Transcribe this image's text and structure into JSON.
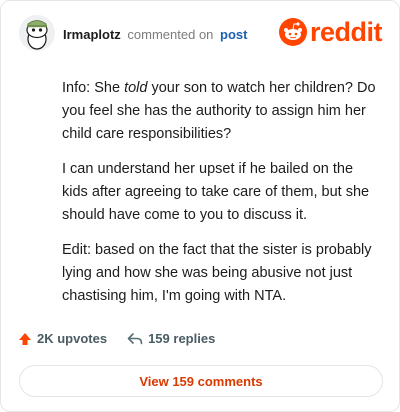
{
  "comment": {
    "username": "Irmaplotz",
    "action_text": "commented on",
    "target_text": "post"
  },
  "brand": {
    "wordmark": "reddit",
    "color": "#ff4500"
  },
  "body": {
    "p1_before": "Info: She ",
    "p1_em": "told",
    "p1_after": " your son to watch her children? Do you feel she has the authority to assign him her child care responsibilities?",
    "p2": "I can understand her upset if he bailed on the kids after agreeing to take care of them, but she should have come to you to discuss it.",
    "p3": "Edit: based on the fact that the sister is probably lying and how she was being abusive not just chastising him, I'm going with NTA."
  },
  "actions": {
    "upvote_icon": "upvote-arrow-icon",
    "upvotes": "2K upvotes",
    "reply_icon": "reply-arrow-icon",
    "replies": "159 replies"
  },
  "footer": {
    "view_button_label": "View 159 comments"
  }
}
